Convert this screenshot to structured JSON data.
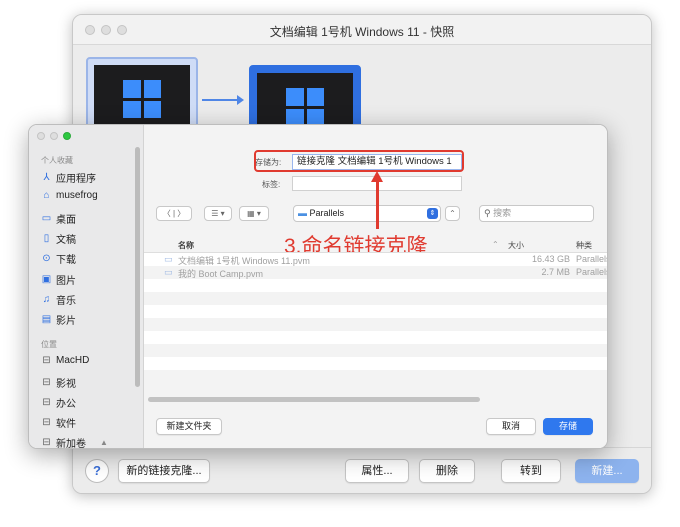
{
  "snapshot_window": {
    "title": "文档编辑 1号机 Windows 11 - 快照",
    "buttons": {
      "help": "?",
      "new_linked_clone": "新的链接克隆...",
      "properties": "属性...",
      "delete": "删除",
      "goto": "转到",
      "new": "新建..."
    }
  },
  "save_dialog": {
    "sidebar": {
      "favorites_header": "个人收藏",
      "favorites": [
        {
          "label": "应用程序",
          "icon": "applications-icon"
        },
        {
          "label": "musefrog",
          "icon": "home-icon"
        },
        {
          "label": "桌面",
          "icon": "desktop-icon"
        },
        {
          "label": "文稿",
          "icon": "documents-icon"
        },
        {
          "label": "下载",
          "icon": "downloads-icon"
        },
        {
          "label": "图片",
          "icon": "pictures-icon"
        },
        {
          "label": "音乐",
          "icon": "music-icon"
        },
        {
          "label": "影片",
          "icon": "movies-icon"
        }
      ],
      "locations_header": "位置",
      "locations": [
        {
          "label": "MacHD"
        },
        {
          "label": "影视"
        },
        {
          "label": "办公"
        },
        {
          "label": "软件"
        },
        {
          "label": "新加卷"
        }
      ]
    },
    "save_as_label": "存储为:",
    "save_as_value": "链接克隆 文档编辑 1号机 Windows 1",
    "tags_label": "标签:",
    "folder": "Parallels",
    "search_placeholder": "搜索",
    "annotation": "3.命名链接克隆",
    "columns": {
      "name": "名称",
      "size": "大小",
      "kind": "种类"
    },
    "files": [
      {
        "name": "文档编辑 1号机 Windows 11.pvm",
        "size": "16.43 GB",
        "kind": "Parallels"
      },
      {
        "name": "我的 Boot Camp.pvm",
        "size": "2.7 MB",
        "kind": "Parallels"
      }
    ],
    "new_folder": "新建文件夹",
    "cancel": "取消",
    "save": "存储"
  }
}
